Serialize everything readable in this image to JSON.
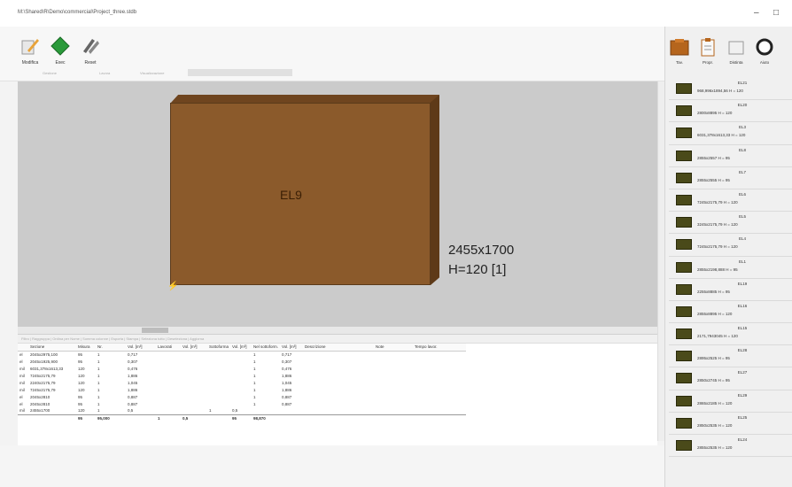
{
  "titlebar": {
    "title": "M:\\Shared\\R\\Demo\\commercial\\Project_three.stdb",
    "minimize": "–",
    "restore": "□"
  },
  "ribbon": {
    "buttons": [
      {
        "label": "Modifica"
      },
      {
        "label": "Exec"
      },
      {
        "label": "Reset"
      }
    ],
    "groups": [
      "Gestione",
      "Lavora",
      "Visualizzazione"
    ]
  },
  "viewport": {
    "panel_name": "EL9",
    "dim_line1": "2455x1700",
    "dim_line2": "H=120 [1]"
  },
  "table": {
    "toolstrip": "Filtro | Raggruppa | Ordina per Nome | Somma colonne | Esporta | Stampa | Seleziona tutto | Deseleziona | Aggiorna",
    "headers": [
      "",
      "Sezione",
      "Misura",
      "Nr.",
      "Vol. [m³]",
      "Lavorati",
      "Vol. [m³]",
      "Sottoforma",
      "Vol. [m³]",
      "Nel sottoform.",
      "Vol. [m³]",
      "Descrizione",
      "Note",
      "Tempo lavor."
    ],
    "rows": [
      [
        "el",
        "2045x2975,100",
        "95",
        "1",
        "0,717",
        "",
        "",
        "",
        "",
        "1",
        "0,717",
        "",
        "",
        ""
      ],
      [
        "el",
        "2045x1925,900",
        "95",
        "1",
        "0,307",
        "",
        "",
        "",
        "",
        "1",
        "0,307",
        "",
        "",
        ""
      ],
      [
        "mil",
        "6031,378x1613,33",
        "120",
        "1",
        "0,476",
        "",
        "",
        "",
        "",
        "1",
        "0,476",
        "",
        "",
        ""
      ],
      [
        "mil",
        "7245x2175,79",
        "120",
        "1",
        "1,886",
        "",
        "",
        "",
        "",
        "1",
        "1,886",
        "",
        "",
        ""
      ],
      [
        "mil",
        "2240x2175,79",
        "120",
        "1",
        "1,045",
        "",
        "",
        "",
        "",
        "1",
        "1,045",
        "",
        "",
        ""
      ],
      [
        "mil",
        "7245x2175,79",
        "120",
        "1",
        "1,886",
        "",
        "",
        "",
        "",
        "1",
        "1,886",
        "",
        "",
        ""
      ],
      [
        "el",
        "2045x2810",
        "95",
        "1",
        "0,887",
        "",
        "",
        "",
        "",
        "1",
        "0,887",
        "",
        "",
        ""
      ],
      [
        "el",
        "2045x2810",
        "95",
        "1",
        "0,887",
        "",
        "",
        "",
        "",
        "1",
        "0,887",
        "",
        "",
        ""
      ],
      [
        "mil",
        "2455x1700",
        "120",
        "1",
        "0,5",
        "",
        "",
        "1",
        "0,5",
        "",
        "",
        "",
        "",
        ""
      ]
    ],
    "total": [
      "",
      "",
      "95",
      "95,000",
      "",
      "1",
      "0,5",
      "",
      "95",
      "98,870",
      "",
      "",
      "",
      ""
    ]
  },
  "sidebar": {
    "tools": [
      {
        "label": "Tav."
      },
      {
        "label": "Propr."
      },
      {
        "label": "Distinta"
      },
      {
        "label": "Aiuto"
      }
    ],
    "items": [
      {
        "name": "EL21",
        "dim": "968,996x1894,56  H = 120"
      },
      {
        "name": "EL20",
        "dim": "2800x8895  H = 120"
      },
      {
        "name": "EL3",
        "dim": "6031,378x1613,33  H = 120"
      },
      {
        "name": "EL8",
        "dim": "2855x2557  H = 95"
      },
      {
        "name": "EL7",
        "dim": "2855x2555  H = 95"
      },
      {
        "name": "EL6",
        "dim": "7245x2175,79  H = 120"
      },
      {
        "name": "EL5",
        "dim": "3245x2175,79  H = 120"
      },
      {
        "name": "EL4",
        "dim": "7245x2175,79  H = 120"
      },
      {
        "name": "EL1",
        "dim": "2855x2198,888  H = 95"
      },
      {
        "name": "EL19",
        "dim": "2255x8885  H = 95"
      },
      {
        "name": "EL16",
        "dim": "2855x8895  H = 120"
      },
      {
        "name": "EL15",
        "dim": "2171,7943045  H = 120"
      },
      {
        "name": "EL28",
        "dim": "2895x2525  H = 95"
      },
      {
        "name": "EL27",
        "dim": "2850x2745  H = 95"
      },
      {
        "name": "EL29",
        "dim": "2865x2185  H = 120"
      },
      {
        "name": "EL25",
        "dim": "2850x2535  H = 120"
      },
      {
        "name": "EL24",
        "dim": "2855x2535  H = 120"
      }
    ]
  }
}
